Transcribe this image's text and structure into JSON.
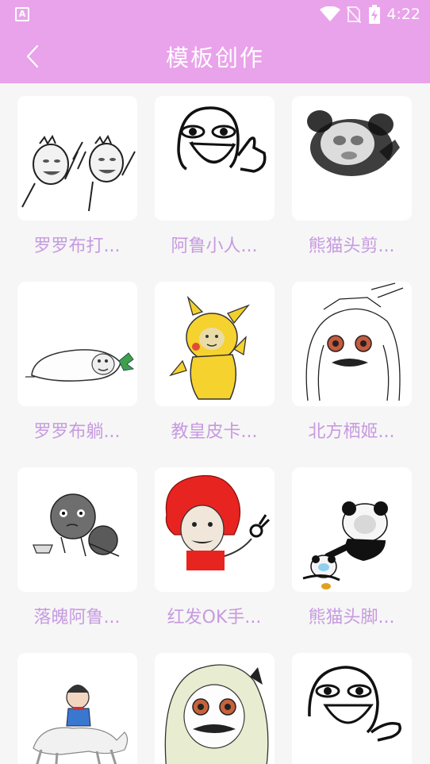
{
  "status_bar": {
    "left_icon": "A",
    "time": "4:22",
    "icons": [
      "wifi-icon",
      "no-sim-icon",
      "battery-charging-icon"
    ]
  },
  "header": {
    "title": "模板创作",
    "back_icon": "chevron-left-icon"
  },
  "colors": {
    "header_bg": "#e9a3ea",
    "label_text": "#c79ae0",
    "page_bg": "#f6f6f6",
    "card_bg": "#ffffff"
  },
  "templates": [
    {
      "label": "罗罗布打...",
      "image": "two-rage-faces-dancing"
    },
    {
      "label": "阿鲁小人...",
      "image": "stick-face-thumbs-up"
    },
    {
      "label": "熊猫头剪...",
      "image": "blurred-panda-head"
    },
    {
      "label": "罗罗布躺...",
      "image": "radish-lying-down"
    },
    {
      "label": "教皇皮卡...",
      "image": "pikachu-face"
    },
    {
      "label": "北方栖姬...",
      "image": "anime-girl-sketch"
    },
    {
      "label": "落魄阿鲁...",
      "image": "sad-ball-with-bowl"
    },
    {
      "label": "红发OK手...",
      "image": "red-hair-ok-hand"
    },
    {
      "label": "熊猫头脚...",
      "image": "panda-kicking-panda"
    },
    {
      "label": "",
      "image": "boy-riding-horse"
    },
    {
      "label": "",
      "image": "anime-girl-mustache"
    },
    {
      "label": "",
      "image": "stick-face-pointing"
    }
  ]
}
